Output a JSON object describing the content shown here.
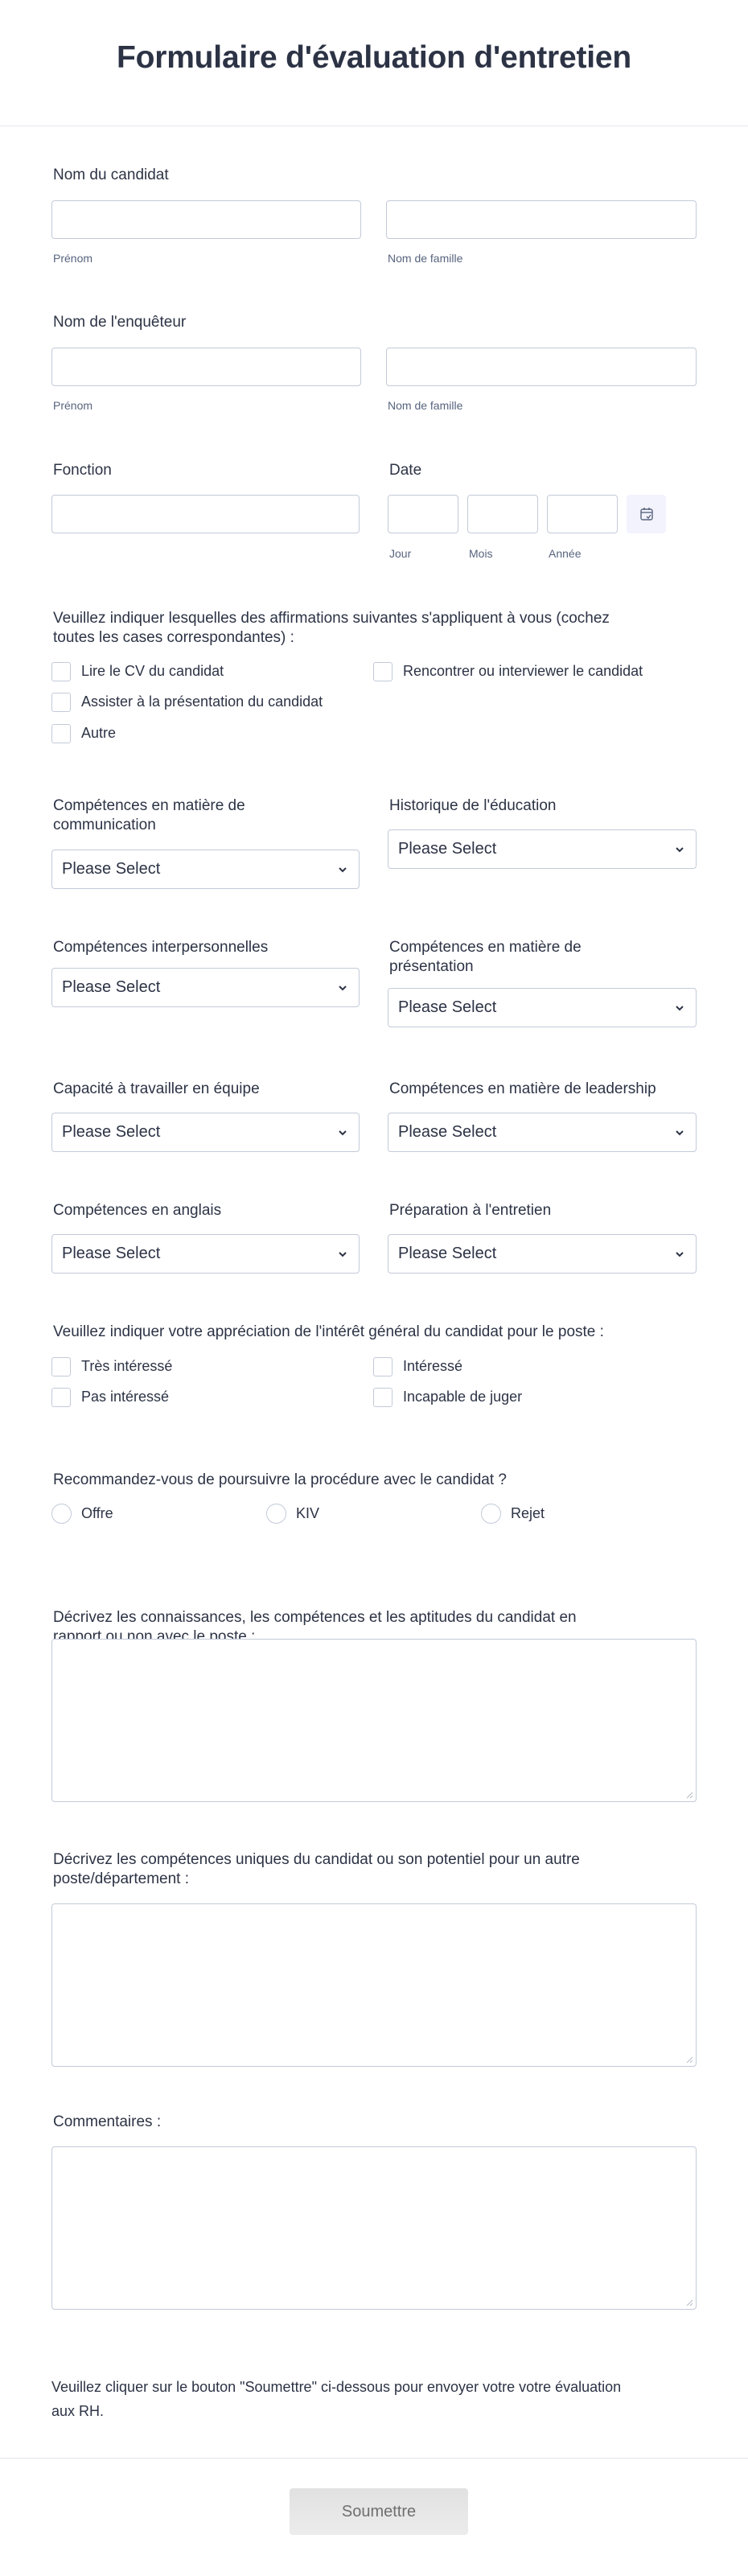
{
  "header": {
    "title": "Formulaire d'évaluation d'entretien"
  },
  "candidate_name": {
    "label": "Nom du candidat",
    "first_sublabel": "Prénom",
    "last_sublabel": "Nom de famille",
    "first_value": "",
    "last_value": ""
  },
  "interviewer_name": {
    "label": "Nom de l'enquêteur",
    "first_sublabel": "Prénom",
    "last_sublabel": "Nom de famille",
    "first_value": "",
    "last_value": ""
  },
  "function": {
    "label": "Fonction",
    "value": ""
  },
  "date": {
    "label": "Date",
    "day_sublabel": "Jour",
    "month_sublabel": "Mois",
    "year_sublabel": "Année",
    "icon": "calendar-check-icon"
  },
  "statements": {
    "question_line1": "Veuillez indiquer lesquelles des affirmations suivantes s'appliquent à vous (cochez",
    "question_line2": "toutes les cases correspondantes) :",
    "options": [
      {
        "label": "Lire le CV du candidat",
        "checked": false
      },
      {
        "label": "Rencontrer ou interviewer le candidat",
        "checked": false
      },
      {
        "label": "Assister à la présentation du candidat",
        "checked": false
      },
      {
        "label": "Autre",
        "checked": false
      }
    ]
  },
  "dropdowns": [
    {
      "label_line1": "Compétences en matière de",
      "label_line2": "communication",
      "value": "Please Select"
    },
    {
      "label_line1": "Historique de l'éducation",
      "label_line2": "",
      "value": "Please Select"
    },
    {
      "label_line1": "Compétences interpersonnelles",
      "label_line2": "",
      "value": "Please Select"
    },
    {
      "label_line1": "Compétences en matière de",
      "label_line2": "présentation",
      "value": "Please Select"
    },
    {
      "label_line1": "Capacité à travailler en équipe",
      "label_line2": "",
      "value": "Please Select"
    },
    {
      "label_line1": "Compétences en matière de leadership",
      "label_line2": "",
      "value": "Please Select"
    },
    {
      "label_line1": "Compétences en anglais",
      "label_line2": "",
      "value": "Please Select"
    },
    {
      "label_line1": "Préparation à l'entretien",
      "label_line2": "",
      "value": "Please Select"
    }
  ],
  "interest": {
    "question": "Veuillez indiquer votre appréciation de l'intérêt général du candidat pour le poste :",
    "options": [
      {
        "label": "Très intéressé",
        "checked": false
      },
      {
        "label": "Intéressé",
        "checked": false
      },
      {
        "label": "Pas intéressé",
        "checked": false
      },
      {
        "label": "Incapable de juger",
        "checked": false
      }
    ]
  },
  "recommend": {
    "question": "Recommandez-vous de poursuivre la procédure avec le candidat ?",
    "options": [
      {
        "label": "Offre",
        "selected": false
      },
      {
        "label": "KIV",
        "selected": false
      },
      {
        "label": "Rejet",
        "selected": false
      }
    ]
  },
  "textareas": [
    {
      "label_line1": "Décrivez les connaissances, les compétences et les aptitudes du candidat en",
      "label_line2": "rapport ou non avec le poste :",
      "value": ""
    },
    {
      "label_line1": "Décrivez les compétences uniques du candidat ou son potentiel pour un autre",
      "label_line2": "poste/département :",
      "value": ""
    },
    {
      "label_line1": "Commentaires :",
      "label_line2": "",
      "value": ""
    }
  ],
  "footer": {
    "note_line1": "Veuillez cliquer sur le bouton \"Soumettre\" ci-dessous pour envoyer votre votre évaluation",
    "note_line2": "aux RH.",
    "submit_label": "Soumettre"
  }
}
